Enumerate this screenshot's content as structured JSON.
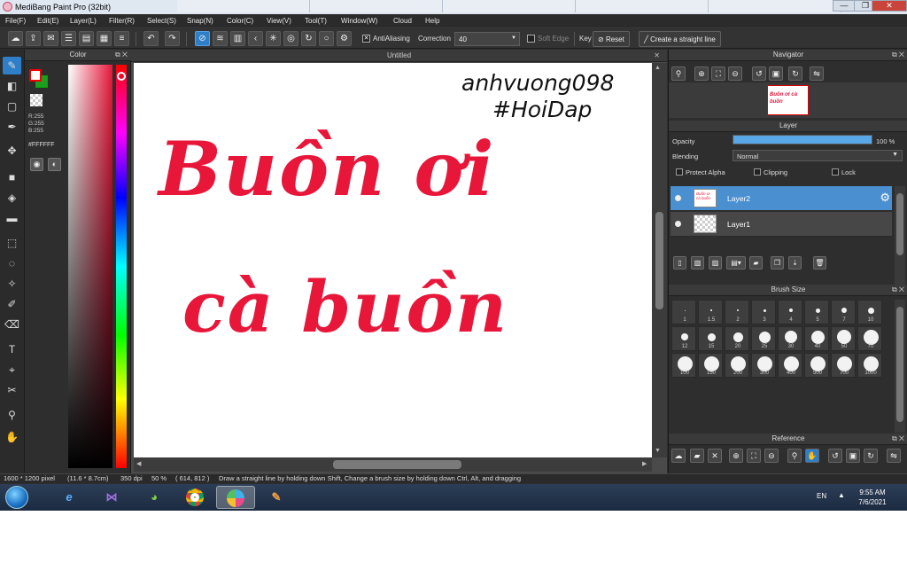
{
  "window": {
    "title": "MediBang Paint Pro (32bit)",
    "controls": {
      "minimize": "—",
      "maximize": "❐",
      "close": "✕"
    }
  },
  "browser_tabs": [
    "",
    "",
    "",
    "",
    ""
  ],
  "menu": [
    "File(F)",
    "Edit(E)",
    "Layer(L)",
    "Filter(R)",
    "Select(S)",
    "Snap(N)",
    "Color(C)",
    "View(V)",
    "Tool(T)",
    "Window(W)",
    "Cloud",
    "Help"
  ],
  "toolbar": {
    "antialiasing_label": "AntiAliasing",
    "antialiasing_checked": true,
    "correction_label": "Correction",
    "correction_value": "40",
    "soft_edge_label": "Soft Edge",
    "key_label": "Key",
    "reset_label": "Reset",
    "straight_line_label": "Create a straight line"
  },
  "color_panel": {
    "title": "Color",
    "r": "R:255",
    "g": "G:255",
    "b": "B:255",
    "hex": "#FFFFFF",
    "foreground_color": "#ffffff",
    "background_color": "#1e9e1e",
    "accent": "#e8173a"
  },
  "canvas": {
    "tab_title": "Untitled",
    "text_line1": "Buồn ơi",
    "text_line2": "cà buồn",
    "handwriting_line1": "anhvuong098",
    "handwriting_line2": "#HoiDap",
    "ink_color": "#e8173a"
  },
  "navigator": {
    "title": "Navigator",
    "thumb_text": "Buồn ơi cà buồn"
  },
  "layer_panel": {
    "title": "Layer",
    "opacity_label": "Opacity",
    "opacity_value": "100 %",
    "opacity_fraction": 1.0,
    "blending_label": "Blending",
    "blending_value": "Normal",
    "protect_alpha_label": "Protect Alpha",
    "clipping_label": "Clipping",
    "lock_label": "Lock",
    "layers": [
      {
        "name": "Layer2",
        "selected": true,
        "thumb_text": "Buồn ơi cà buồn"
      },
      {
        "name": "Layer1",
        "selected": false,
        "thumb_text": ""
      }
    ]
  },
  "brush_size": {
    "title": "Brush Size",
    "sizes": [
      "1",
      "1.5",
      "2",
      "3",
      "4",
      "5",
      "7",
      "10",
      "12",
      "15",
      "20",
      "25",
      "30",
      "40",
      "50",
      "70",
      "100",
      "150",
      "200",
      "300",
      "400",
      "500",
      "700",
      "1000"
    ]
  },
  "reference": {
    "title": "Reference"
  },
  "status": {
    "size": "1600 * 1200 pixel",
    "physical": "(11.6 * 8.7cm)",
    "dpi": "350 dpi",
    "zoom": "50 %",
    "coords": "( 614, 812 )",
    "hint": "Draw a straight line by holding down Shift, Change a brush size by holding down Ctrl, Alt, and dragging"
  },
  "taskbar": {
    "language": "EN",
    "time": "9:55 AM",
    "date": "7/6/2021"
  }
}
